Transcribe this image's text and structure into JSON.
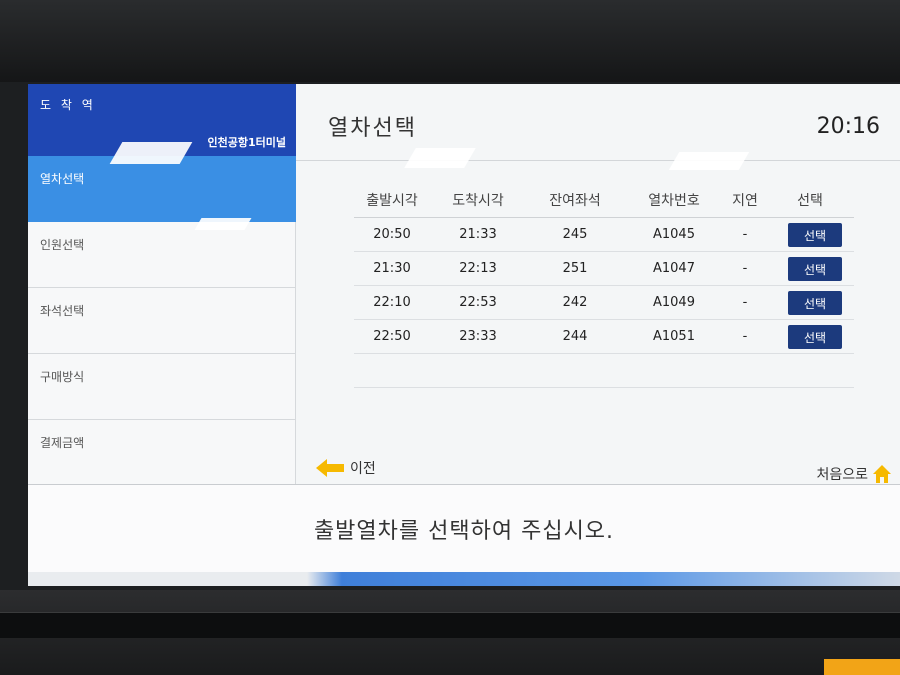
{
  "sidebar": {
    "destination_label": "도 착 역",
    "destination_value": "인천공항1터미널",
    "steps": [
      {
        "label": "열차선택",
        "active": true
      },
      {
        "label": "인원선택",
        "active": false
      },
      {
        "label": "좌석선택",
        "active": false
      },
      {
        "label": "구매방식",
        "active": false
      },
      {
        "label": "결제금액",
        "active": false
      }
    ]
  },
  "header": {
    "title": "열차선택",
    "clock": "20:16"
  },
  "table": {
    "columns": [
      "출발시각",
      "도착시각",
      "잔여좌석",
      "열차번호",
      "지연",
      "선택"
    ],
    "rows": [
      {
        "depart": "20:50",
        "arrive": "21:33",
        "seats": "245",
        "train": "A1045",
        "delay": "-",
        "button": "선택"
      },
      {
        "depart": "21:30",
        "arrive": "22:13",
        "seats": "251",
        "train": "A1047",
        "delay": "-",
        "button": "선택"
      },
      {
        "depart": "22:10",
        "arrive": "22:53",
        "seats": "242",
        "train": "A1049",
        "delay": "-",
        "button": "선택"
      },
      {
        "depart": "22:50",
        "arrive": "23:33",
        "seats": "244",
        "train": "A1051",
        "delay": "-",
        "button": "선택"
      }
    ]
  },
  "nav": {
    "prev_label": "이전",
    "home_label": "처음으로",
    "prev_icon": "arrow-left-icon",
    "home_icon": "home-icon",
    "accent": "#f6b900"
  },
  "message": "출발열차를 선택하여 주십시오.",
  "colors": {
    "sidebar_header": "#1f47b3",
    "active_step": "#3a8fe4",
    "select_button": "#1c3a7d"
  }
}
